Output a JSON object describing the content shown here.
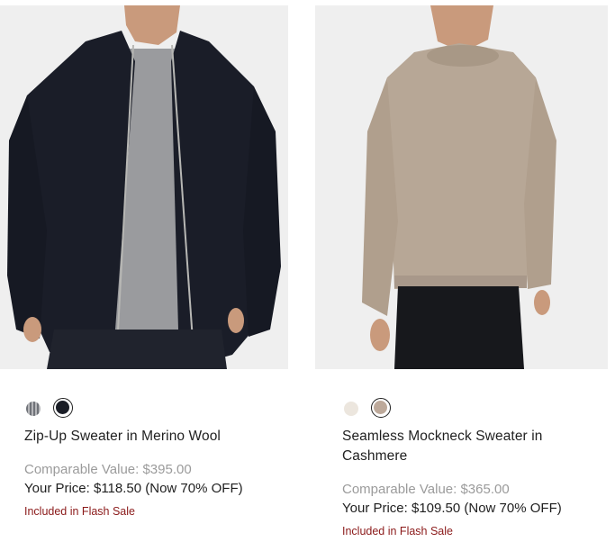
{
  "products": [
    {
      "title": "Zip-Up Sweater in Merino Wool",
      "comparable_value": "Comparable Value: $395.00",
      "your_price": "Your Price: $118.50 (Now 70% OFF)",
      "flash_sale": "Included in Flash Sale",
      "swatches": [
        {
          "name": "grey-heather",
          "color": "#8e9095",
          "selected": false
        },
        {
          "name": "navy",
          "color": "#1a1d26",
          "selected": true
        }
      ]
    },
    {
      "title": "Seamless Mockneck Sweater in Cashmere",
      "comparable_value": "Comparable Value: $365.00",
      "your_price": "Your Price: $109.50 (Now 70% OFF)",
      "flash_sale": "Included in Flash Sale",
      "swatches": [
        {
          "name": "ivory",
          "color": "#ece6de",
          "selected": false
        },
        {
          "name": "taupe",
          "color": "#bda99a",
          "selected": true
        }
      ]
    }
  ],
  "colors": {
    "flash_sale": "#8b1a1a",
    "comparable": "#9b9b9b",
    "image_background": "#efefef"
  }
}
